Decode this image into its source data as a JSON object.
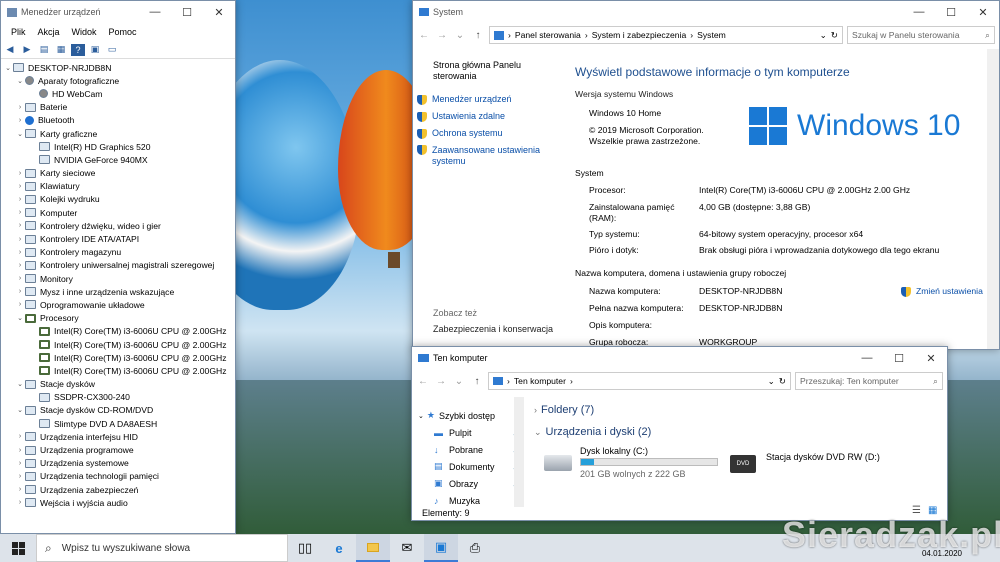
{
  "device_manager": {
    "title": "Menedżer urządzeń",
    "menu": [
      "Plik",
      "Akcja",
      "Widok",
      "Pomoc"
    ],
    "root": "DESKTOP-NRJDB8N",
    "tree": [
      {
        "label": "Aparaty fotograficzne",
        "expanded": true,
        "icon": "camera-icon"
      },
      {
        "label": "HD WebCam",
        "child": true,
        "icon": "camera-icon"
      },
      {
        "label": "Baterie",
        "expanded": false,
        "icon": "battery-icon"
      },
      {
        "label": "Bluetooth",
        "expanded": false,
        "icon": "bluetooth-icon"
      },
      {
        "label": "Karty graficzne",
        "expanded": true,
        "icon": "display-adapter-icon"
      },
      {
        "label": "Intel(R) HD Graphics 520",
        "child": true,
        "icon": "display-adapter-icon"
      },
      {
        "label": "NVIDIA GeForce 940MX",
        "child": true,
        "icon": "display-adapter-icon"
      },
      {
        "label": "Karty sieciowe",
        "expanded": false,
        "icon": "network-icon"
      },
      {
        "label": "Klawiatury",
        "expanded": false,
        "icon": "keyboard-icon"
      },
      {
        "label": "Kolejki wydruku",
        "expanded": false,
        "icon": "printer-icon"
      },
      {
        "label": "Komputer",
        "expanded": false,
        "icon": "computer-icon"
      },
      {
        "label": "Kontrolery dźwięku, wideo i gier",
        "expanded": false,
        "icon": "sound-icon"
      },
      {
        "label": "Kontrolery IDE ATA/ATAPI",
        "expanded": false,
        "icon": "ide-icon"
      },
      {
        "label": "Kontrolery magazynu",
        "expanded": false,
        "icon": "storage-icon"
      },
      {
        "label": "Kontrolery uniwersalnej magistrali szeregowej",
        "expanded": false,
        "icon": "usb-icon"
      },
      {
        "label": "Monitory",
        "expanded": false,
        "icon": "monitor-icon"
      },
      {
        "label": "Mysz i inne urządzenia wskazujące",
        "expanded": false,
        "icon": "mouse-icon"
      },
      {
        "label": "Oprogramowanie układowe",
        "expanded": false,
        "icon": "firmware-icon"
      },
      {
        "label": "Procesory",
        "expanded": true,
        "icon": "cpu-icon"
      },
      {
        "label": "Intel(R) Core(TM) i3-6006U CPU @ 2.00GHz",
        "child": true,
        "icon": "cpu-icon"
      },
      {
        "label": "Intel(R) Core(TM) i3-6006U CPU @ 2.00GHz",
        "child": true,
        "icon": "cpu-icon"
      },
      {
        "label": "Intel(R) Core(TM) i3-6006U CPU @ 2.00GHz",
        "child": true,
        "icon": "cpu-icon"
      },
      {
        "label": "Intel(R) Core(TM) i3-6006U CPU @ 2.00GHz",
        "child": true,
        "icon": "cpu-icon"
      },
      {
        "label": "Stacje dysków",
        "expanded": true,
        "icon": "disk-icon"
      },
      {
        "label": "SSDPR-CX300-240",
        "child": true,
        "icon": "disk-icon"
      },
      {
        "label": "Stacje dysków CD-ROM/DVD",
        "expanded": true,
        "icon": "dvd-icon"
      },
      {
        "label": "Slimtype DVD A  DA8AESH",
        "child": true,
        "icon": "dvd-icon"
      },
      {
        "label": "Urządzenia interfejsu HID",
        "expanded": false,
        "icon": "hid-icon"
      },
      {
        "label": "Urządzenia programowe",
        "expanded": false,
        "icon": "software-device-icon"
      },
      {
        "label": "Urządzenia systemowe",
        "expanded": false,
        "icon": "system-device-icon"
      },
      {
        "label": "Urządzenia technologii pamięci",
        "expanded": false,
        "icon": "memory-icon"
      },
      {
        "label": "Urządzenia zabezpieczeń",
        "expanded": false,
        "icon": "security-icon"
      },
      {
        "label": "Wejścia i wyjścia audio",
        "expanded": false,
        "icon": "audio-icon"
      }
    ]
  },
  "system": {
    "title": "System",
    "breadcrumb": [
      "Panel sterowania",
      "System i zabezpieczenia",
      "System"
    ],
    "search_placeholder": "Szukaj w Panelu sterowania",
    "sidebar_home": "Strona główna Panelu sterowania",
    "sidebar_links": [
      "Menedżer urządzeń",
      "Ustawienia zdalne",
      "Ochrona systemu",
      "Zaawansowane ustawienia systemu"
    ],
    "see_also": "Zobacz też",
    "see_also_link": "Zabezpieczenia i konserwacja",
    "heading": "Wyświetl podstawowe informacje o tym komputerze",
    "edition_section": "Wersja systemu Windows",
    "edition": "Windows 10 Home",
    "copyright": "© 2019 Microsoft Corporation. Wszelkie prawa zastrzeżone.",
    "logo_text": "Windows 10",
    "system_section": "System",
    "rows": [
      {
        "k": "Procesor:",
        "v": "Intel(R) Core(TM) i3-6006U CPU @ 2.00GHz   2.00 GHz"
      },
      {
        "k": "Zainstalowana pamięć (RAM):",
        "v": "4,00 GB (dostępne: 3,88 GB)"
      },
      {
        "k": "Typ systemu:",
        "v": "64-bitowy system operacyjny, procesor x64"
      },
      {
        "k": "Pióro i dotyk:",
        "v": "Brak obsługi pióra i wprowadzania dotykowego dla tego ekranu"
      }
    ],
    "name_section": "Nazwa komputera, domena i ustawienia grupy roboczej",
    "name_rows": [
      {
        "k": "Nazwa komputera:",
        "v": "DESKTOP-NRJDB8N"
      },
      {
        "k": "Pełna nazwa komputera:",
        "v": "DESKTOP-NRJDB8N"
      },
      {
        "k": "Opis komputera:",
        "v": ""
      },
      {
        "k": "Grupa robocza:",
        "v": "WORKGROUP"
      }
    ],
    "change_settings": "Zmień ustawienia"
  },
  "explorer": {
    "title": "Ten komputer",
    "address": "Ten komputer",
    "search_placeholder": "Przeszukaj: Ten komputer",
    "nav": [
      "Szybki dostęp",
      "Pulpit",
      "Pobrane",
      "Dokumenty",
      "Obrazy",
      "Muzyka"
    ],
    "folders_header": "Foldery (7)",
    "devices_header": "Urządzenia i dyski (2)",
    "disk_name": "Dysk lokalny (C:)",
    "disk_free": "201 GB wolnych z 222 GB",
    "disk_used_fraction": 0.095,
    "dvd_name": "Stacja dysków DVD RW (D:)",
    "status": "Elementy: 9"
  },
  "taskbar": {
    "search_placeholder": "Wpisz tu wyszukiwane słowa",
    "date": "04.01.2020"
  },
  "watermark": "Sieradzak.pl"
}
